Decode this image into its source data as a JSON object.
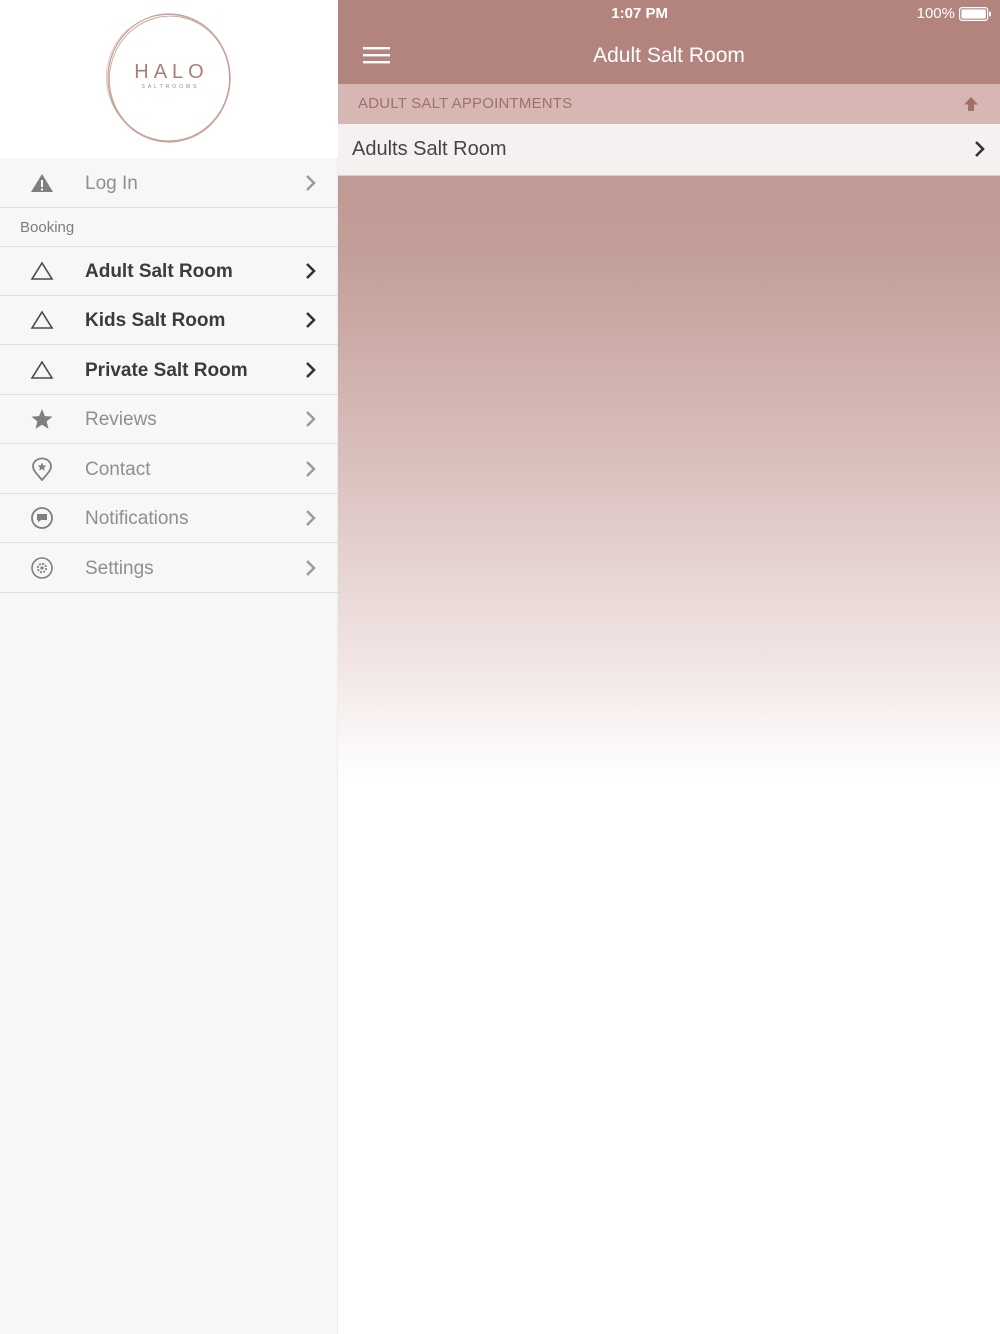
{
  "status_bar": {
    "time": "1:07 PM",
    "battery": "100%"
  },
  "logo": {
    "name": "HALO",
    "subtitle": "SALTROOMS"
  },
  "sidebar": {
    "login": {
      "label": "Log In",
      "icon": "warning-icon"
    },
    "section_title": "Booking",
    "booking_items": [
      {
        "label": "Adult Salt Room",
        "icon": "triangle-outline-icon"
      },
      {
        "label": "Kids Salt Room",
        "icon": "triangle-outline-icon"
      },
      {
        "label": "Private Salt Room",
        "icon": "triangle-outline-icon"
      }
    ],
    "items": [
      {
        "label": "Reviews",
        "icon": "star-icon"
      },
      {
        "label": "Contact",
        "icon": "location-pin-icon"
      },
      {
        "label": "Notifications",
        "icon": "chat-bubble-icon"
      },
      {
        "label": "Settings",
        "icon": "gear-icon"
      }
    ]
  },
  "header": {
    "title": "Adult Salt Room"
  },
  "main": {
    "section_header": "ADULT SALT APPOINTMENTS",
    "list": [
      {
        "label": "Adults Salt Room"
      }
    ]
  },
  "colors": {
    "brand": "#b3847e",
    "section_header_bg": "#d6b7b3",
    "section_header_text": "#a26f69",
    "sidebar_bg": "#f7f7f7"
  }
}
